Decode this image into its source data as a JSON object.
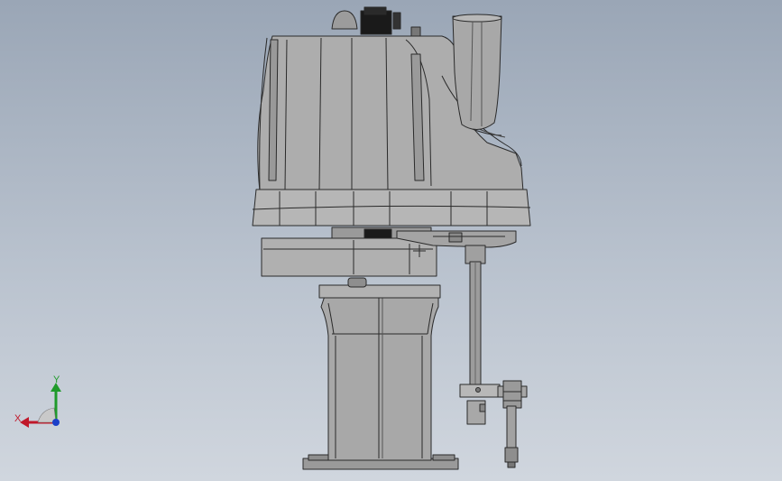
{
  "viewport": {
    "background_top": "#9aa6b6",
    "background_bottom": "#d0d6de"
  },
  "model": {
    "icon": "scara-robot-model",
    "shade_light": "#b4b4b4",
    "shade_mid": "#a2a2a2",
    "shade_dark": "#8e8e8e",
    "edge_color": "#2a2a2a"
  },
  "triad": {
    "x_label": "X",
    "y_label": "Y",
    "x_color": "#c0182a",
    "y_color": "#1f9a2a",
    "z_color": "#1b3fc9"
  }
}
